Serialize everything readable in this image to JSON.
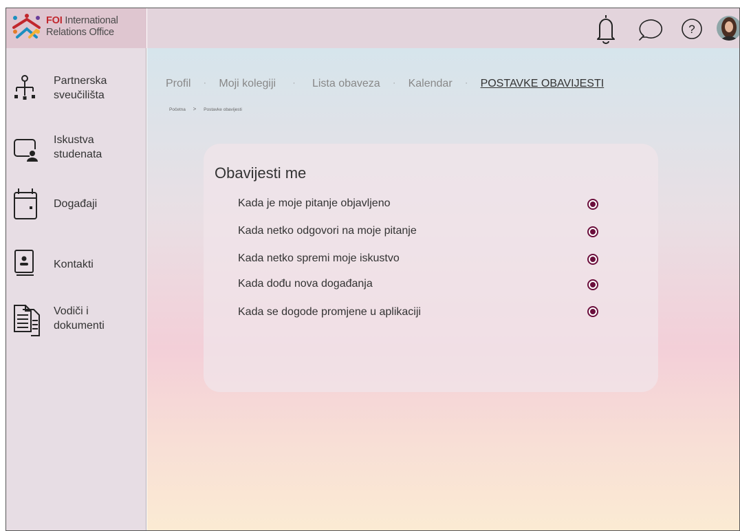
{
  "logo": {
    "brand": "FOI",
    "line1": " International",
    "line2": "Relations Office"
  },
  "sidebar": {
    "items": [
      {
        "line1": "Partnerska",
        "line2": "sveučilišta",
        "icon": "hierarchy-icon"
      },
      {
        "line1": "Iskustva",
        "line2": "studenata",
        "icon": "user-screen-icon"
      },
      {
        "line1": "Događaji",
        "line2": "",
        "icon": "calendar-icon"
      },
      {
        "line1": "Kontakti",
        "line2": "",
        "icon": "contact-book-icon"
      },
      {
        "line1": "Vodiči i",
        "line2": "dokumenti",
        "icon": "documents-icon"
      }
    ]
  },
  "topbar": {
    "icons": [
      "bell-icon",
      "chat-icon",
      "help-icon",
      "avatar"
    ],
    "help_glyph": "?"
  },
  "tabs": {
    "items": [
      "Profil",
      "Moji kolegiji",
      "Lista obaveza",
      "Kalendar",
      "POSTAVKE OBAVIJESTI"
    ],
    "separator": "·"
  },
  "breadcrumb": {
    "home": "Početna",
    "chevron": ">",
    "current": "Postavke obavijesti"
  },
  "notifications": {
    "title": "Obavijesti me",
    "options": [
      "Kada je moje pitanje objavljeno",
      "Kada netko odgovori na moje pitanje",
      "Kada netko spremi moje iskustvo",
      "Kada dođu nova događanja",
      "Kada se dogode promjene u aplikaciji"
    ]
  },
  "colors": {
    "accent": "#6b0f3c",
    "brand_red": "#c1272d"
  }
}
